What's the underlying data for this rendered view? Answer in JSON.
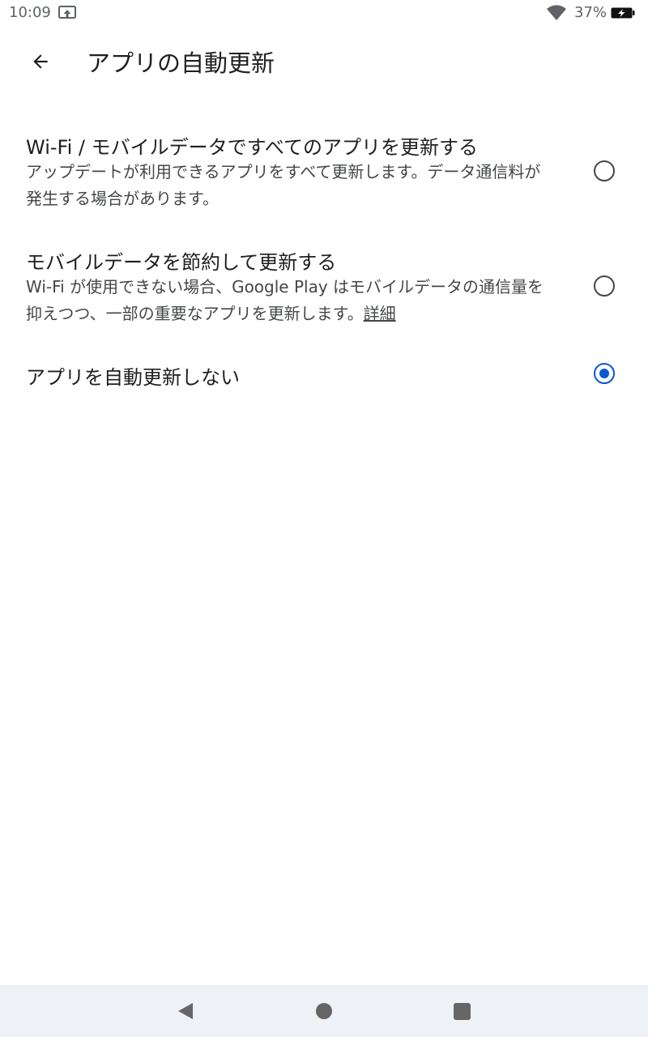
{
  "status_bar": {
    "time": "10:09",
    "battery_percent": "37%"
  },
  "header": {
    "title": "アプリの自動更新",
    "back_icon": "arrow-back-icon"
  },
  "options": [
    {
      "title": "Wi-Fi / モバイルデータですべてのアプリを更新する",
      "description": "アップデートが利用できるアプリをすべて更新します。データ通信料が発生する場合があります。",
      "selected": false
    },
    {
      "title": "モバイルデータを節約して更新する",
      "description": "Wi-Fi が使用できない場合、Google Play はモバイルデータの通信量を抑えつつ、一部の重要なアプリを更新します。",
      "link": "詳細",
      "selected": false
    },
    {
      "title": "アプリを自動更新しない",
      "selected": true
    }
  ],
  "colors": {
    "accent": "#0b57d0",
    "nav_bar": "#eef1f6"
  }
}
